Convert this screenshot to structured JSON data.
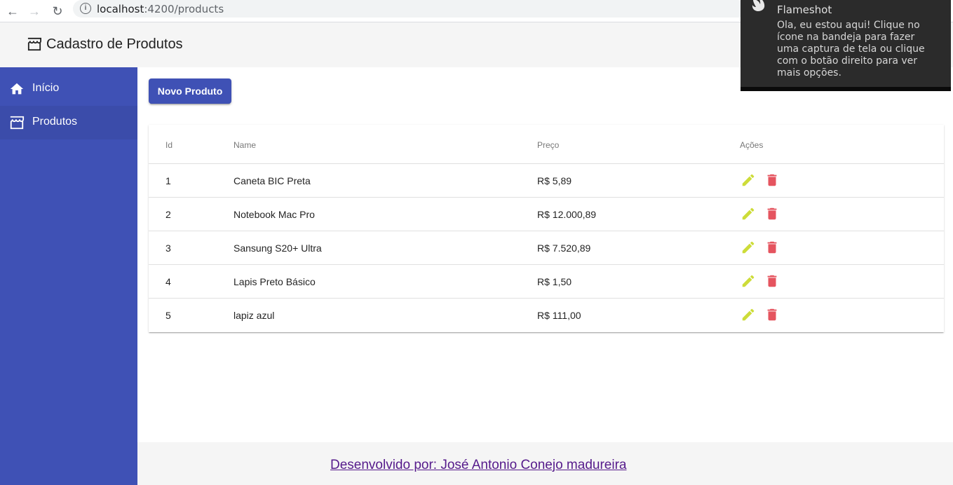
{
  "browser": {
    "url_host": "localhost",
    "url_path": ":4200/products"
  },
  "toolbar": {
    "title": "Cadastro de Produtos"
  },
  "sidebar": {
    "items": [
      {
        "label": "Início",
        "icon": "home-icon"
      },
      {
        "label": "Produtos",
        "icon": "storefront-icon"
      }
    ]
  },
  "main": {
    "new_button_label": "Novo Produto"
  },
  "table": {
    "headers": [
      "Id",
      "Name",
      "Preço",
      "Ações"
    ],
    "rows": [
      {
        "id": "1",
        "name": "Caneta BIC Preta",
        "price": "R$ 5,89"
      },
      {
        "id": "2",
        "name": "Notebook Mac Pro",
        "price": "R$ 12.000,89"
      },
      {
        "id": "3",
        "name": "Sansung S20+ Ultra",
        "price": "R$ 7.520,89"
      },
      {
        "id": "4",
        "name": "Lapis Preto Básico",
        "price": "R$ 1,50"
      },
      {
        "id": "5",
        "name": "lapiz azul",
        "price": "R$ 111,00"
      }
    ]
  },
  "footer": {
    "link_text": "Desenvolvido por: José Antonio Conejo madureira"
  },
  "notification": {
    "title": "Flameshot",
    "body": "Ola, eu estou aqui! Clique no ícone na bandeja para fazer uma captura de tela ou clique com o botão direito para ver mais opções."
  },
  "colors": {
    "primary": "#3f51b5",
    "edit": "#cddc39",
    "delete": "#e5545f"
  }
}
